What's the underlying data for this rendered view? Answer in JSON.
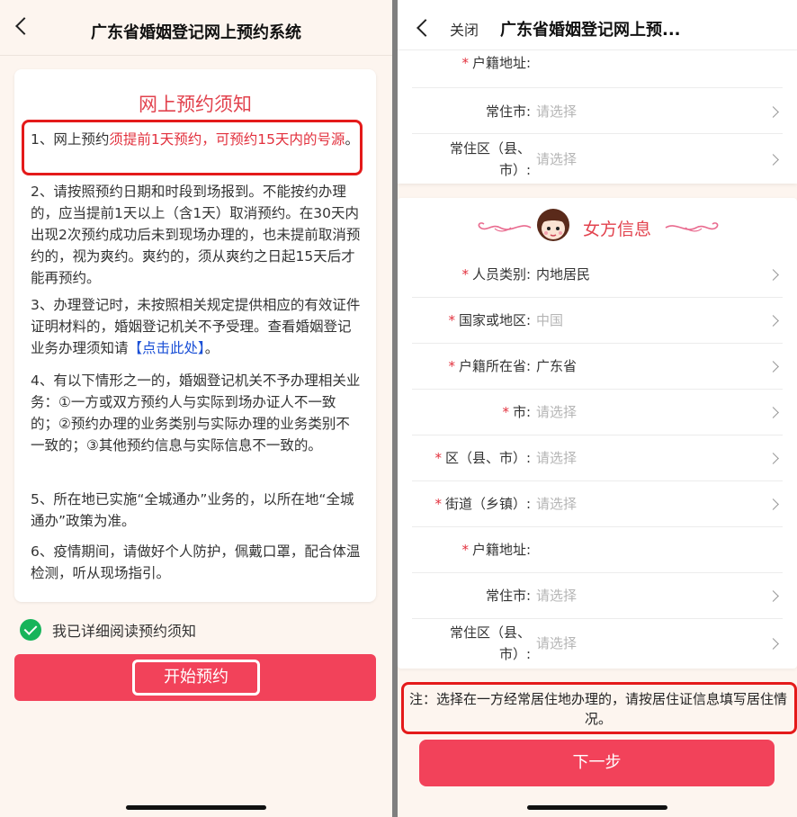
{
  "left": {
    "header": {
      "title": "广东省婚姻登记网上预约系统"
    },
    "card": {
      "title": "网上预约须知",
      "item1": {
        "prefix": "1、网上预约",
        "hl1": "须提前1天预约",
        "mid": "，",
        "hl2": "可预约15天内的号源",
        "suffix": "。"
      },
      "item2": "2、请按照预约日期和时段到场报到。不能按约办理的，应当提前1天以上（含1天）取消预约。在30天内出现2次预约成功后未到现场办理的，也未提前取消预约的，视为爽约。爽约的，须从爽约之日起15天后才能再预约。",
      "item3": {
        "text": "3、办理登记时，未按照相关规定提供相应的有效证件证明材料的，婚姻登记机关不予受理。查看婚姻登记业务办理须知请",
        "link": "【点击此处】",
        "suffix": "。"
      },
      "item4": "4、有以下情形之一的，婚姻登记机关不予办理相关业务：①一方或双方预约人与实际到场办证人不一致的；②预约办理的业务类别与实际办理的业务类别不一致的；③其他预约信息与实际信息不一致的。",
      "item5": "5、所在地已实施“全城通办”业务的，以所在地“全城通办”政策为准。",
      "item6": "6、疫情期间，请做好个人防护，佩戴口罩，配合体温检测，听从现场指引。"
    },
    "agree_text": "我已详细阅读预约须知",
    "start_button": "开始预约"
  },
  "right": {
    "header": {
      "close": "关闭",
      "title": "广东省婚姻登记网上预..."
    },
    "top_rows": [
      {
        "label": "户籍地址:",
        "required": true,
        "value": "",
        "placeholder": false
      },
      {
        "label": "常住市:",
        "required": false,
        "value": "请选择",
        "placeholder": true
      },
      {
        "label_line1": "常住区（县、",
        "label_line2": "市）:",
        "required": false,
        "value": "请选择",
        "placeholder": true
      }
    ],
    "female_section": {
      "title": "女方信息",
      "rows": [
        {
          "label": "人员类别:",
          "required": true,
          "value": "内地居民",
          "placeholder": false
        },
        {
          "label": "国家或地区:",
          "required": true,
          "value": "中国",
          "placeholder": true
        },
        {
          "label": "户籍所在省:",
          "required": true,
          "value": "广东省",
          "placeholder": false
        },
        {
          "label": "市:",
          "required": true,
          "value": "请选择",
          "placeholder": true
        },
        {
          "label": "区（县、市）:",
          "required": true,
          "value": "请选择",
          "placeholder": true
        },
        {
          "label": "街道（乡镇）:",
          "required": true,
          "value": "请选择",
          "placeholder": true
        },
        {
          "label": "户籍地址:",
          "required": true,
          "value": "",
          "placeholder": false
        },
        {
          "label": "常住市:",
          "required": false,
          "value": "请选择",
          "placeholder": true
        },
        {
          "label_line1": "常住区（县、",
          "label_line2": "市）:",
          "required": false,
          "value": "请选择",
          "placeholder": true
        }
      ]
    },
    "note": "注：选择在一方经常居住地办理的，请按居住证信息填写居住情况。",
    "next_button": "下一步",
    "star": "*"
  },
  "colors": {
    "accent": "#f2425a",
    "highlight_red": "#e2303d",
    "link_blue": "#1a4fd6",
    "check_green": "#17b45a",
    "annotation_red": "#e41a1a"
  }
}
